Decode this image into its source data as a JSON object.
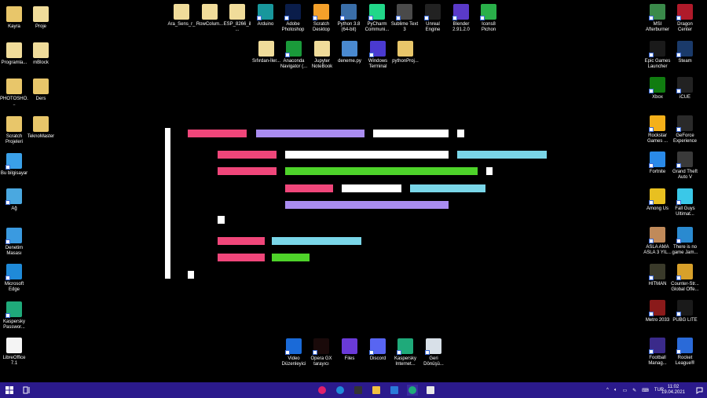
{
  "desktop": {
    "left": [
      {
        "label": "Kayra",
        "icon": "user-folder-icon",
        "color": "#e8c66a"
      },
      {
        "label": "Proje",
        "icon": "folder-icon",
        "color": "#f0dc9a"
      },
      {
        "label": "Programla...",
        "icon": "folder-icon",
        "color": "#f0dc9a"
      },
      {
        "label": "mBlock",
        "icon": "folder-icon",
        "color": "#f0dc9a"
      },
      {
        "label": "PHOTOSHO...",
        "icon": "folder-icon",
        "color": "#e8c66a"
      },
      {
        "label": "Ders",
        "icon": "folder-icon",
        "color": "#e8c66a"
      },
      {
        "label": "Scratch Projeleri",
        "icon": "folder-icon",
        "color": "#e8c66a"
      },
      {
        "label": "TeknoMaster",
        "icon": "folder-icon",
        "color": "#e8c66a"
      },
      {
        "label": "Bu bilgisayar",
        "icon": "computer-icon",
        "color": "#3aa0e8"
      },
      {
        "label": "Ağ",
        "icon": "network-icon",
        "color": "#4aa8e0"
      },
      {
        "label": "Denetim Masası",
        "icon": "control-panel-icon",
        "color": "#3a9ae0"
      },
      {
        "label": "Microsoft Edge",
        "icon": "edge-icon",
        "color": "#1f8ad8"
      },
      {
        "label": "Kaspersky Passwor...",
        "icon": "kaspersky-icon",
        "color": "#1faa7a"
      },
      {
        "label": "LibreOffice 7.1",
        "icon": "document-icon",
        "color": "#f4f4f4"
      }
    ],
    "top": [
      {
        "label": "Ara_Sens_r_",
        "icon": "arduino-file-icon",
        "color": "#f0dc9a"
      },
      {
        "label": "RowColum...",
        "icon": "arduino-file-icon",
        "color": "#f0dc9a"
      },
      {
        "label": "ESP_8266_il...",
        "icon": "arduino-file-icon",
        "color": "#f0dc9a"
      },
      {
        "label": "Arduino",
        "icon": "arduino-icon",
        "color": "#18979c"
      },
      {
        "label": "Adobe Photoshop",
        "icon": "photoshop-icon",
        "color": "#0a1d4a"
      },
      {
        "label": "Scratch Desktop",
        "icon": "scratch-icon",
        "color": "#f4a02a"
      },
      {
        "label": "Python 3.8 (64-bit)",
        "icon": "python-icon",
        "color": "#3a6ea8"
      },
      {
        "label": "PyCharm Communi...",
        "icon": "pycharm-icon",
        "color": "#21d789"
      },
      {
        "label": "Sublime Text 3",
        "icon": "sublime-icon",
        "color": "#4a4a4a"
      },
      {
        "label": "Unreal Engine",
        "icon": "unreal-icon",
        "color": "#222222"
      },
      {
        "label": "Blender 2.91.2.0",
        "icon": "blender-icon",
        "color": "#5a3ac8"
      },
      {
        "label": "Icons8 Pichon",
        "icon": "pichon-icon",
        "color": "#2ab04a"
      },
      {
        "label": "Sıfırdan-İler...",
        "icon": "file-icon",
        "color": "#f0dc9a"
      },
      {
        "label": "Anaconda Navigator (...",
        "icon": "anaconda-icon",
        "color": "#1a9a3a"
      },
      {
        "label": "Jupyter NoteBook",
        "icon": "file-icon",
        "color": "#f0dc9a"
      },
      {
        "label": "deneme.py",
        "icon": "python-file-icon",
        "color": "#4a8ad0"
      },
      {
        "label": "Windows Terminal",
        "icon": "terminal-icon",
        "color": "#4a3ad0"
      },
      {
        "label": "pythonProj...",
        "icon": "folder-icon",
        "color": "#e8c66a"
      }
    ],
    "right": [
      {
        "label": "MSI Afterburner",
        "icon": "msi-icon",
        "color": "#3a8a4a"
      },
      {
        "label": "Dragon Center",
        "icon": "dragon-icon",
        "color": "#b01a2a"
      },
      {
        "label": "Epic Games Launcher",
        "icon": "epic-icon",
        "color": "#1a1a1a"
      },
      {
        "label": "Steam",
        "icon": "steam-icon",
        "color": "#1a3a6a"
      },
      {
        "label": "Xbox",
        "icon": "xbox-icon",
        "color": "#107c10"
      },
      {
        "label": "iCUE",
        "icon": "icue-icon",
        "color": "#222222"
      },
      {
        "label": "Rockstar Games ...",
        "icon": "rockstar-icon",
        "color": "#f4b01a"
      },
      {
        "label": "GeForce Experience",
        "icon": "nvidia-icon",
        "color": "#2a2a2a"
      },
      {
        "label": "Fortnite",
        "icon": "fortnite-icon",
        "color": "#2a8ae8"
      },
      {
        "label": "Grand Theft Auto V",
        "icon": "gta-icon",
        "color": "#3a3a3a"
      },
      {
        "label": "Among Us",
        "icon": "among-us-icon",
        "color": "#e8c020"
      },
      {
        "label": "Fall Guys Ultimat...",
        "icon": "fall-guys-icon",
        "color": "#3ac8e8"
      },
      {
        "label": "ASLA AMA ASLA 3 YIL...",
        "icon": "game-icon",
        "color": "#c08a5a"
      },
      {
        "label": "There is no game Jam...",
        "icon": "game-icon",
        "color": "#2a8ad0"
      },
      {
        "label": "HITMAN",
        "icon": "hitman-icon",
        "color": "#3a3a2a"
      },
      {
        "label": "Counter-Str... Global Offe...",
        "icon": "csgo-icon",
        "color": "#d8a02a"
      },
      {
        "label": "Metro 2033",
        "icon": "metro-icon",
        "color": "#8a1a1a"
      },
      {
        "label": "PUBG LITE",
        "icon": "pubg-icon",
        "color": "#1a1a1a"
      },
      {
        "label": "Football Manag...",
        "icon": "football-manager-icon",
        "color": "#3a2a8a"
      },
      {
        "label": "Rocket League®",
        "icon": "rocket-league-icon",
        "color": "#2a6ad8"
      }
    ],
    "bottom": [
      {
        "label": "Video Düzenleyici",
        "icon": "video-editor-icon",
        "color": "#1a6ad8"
      },
      {
        "label": "Opera GX tarayıcı",
        "icon": "opera-gx-icon",
        "color": "#1a0a0a"
      },
      {
        "label": "Files",
        "icon": "files-icon",
        "color": "#6a3ad8"
      },
      {
        "label": "Discord",
        "icon": "discord-icon",
        "color": "#5865f2"
      },
      {
        "label": "Kaspersky Internet...",
        "icon": "kaspersky-icon",
        "color": "#1faa7a"
      },
      {
        "label": "Geri Dönüşü...",
        "icon": "recycle-bin-icon",
        "color": "#d8e0e8"
      }
    ]
  },
  "wallpaper_colors": {
    "pink": "#f0467a",
    "purple": "#a98cf0",
    "white": "#ffffff",
    "cyan": "#7ad6e8",
    "green": "#4ed32a"
  },
  "taskbar": {
    "color": "#2b1a8c",
    "pinned": [
      "opera-gx-icon",
      "edge-icon",
      "terminal-icon",
      "file-explorer-icon",
      "mail-icon",
      "kaspersky-icon",
      "store-icon"
    ],
    "language": "TUR",
    "time": "11:02",
    "date": "19.04.2021"
  }
}
